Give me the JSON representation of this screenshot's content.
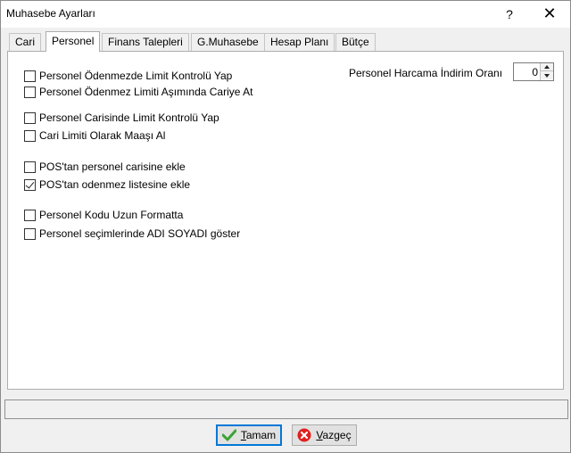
{
  "window": {
    "title": "Muhasebe Ayarları",
    "help_label": "?",
    "close_label": "✕"
  },
  "tabs": [
    {
      "label": "Cari",
      "active": false
    },
    {
      "label": "Personel",
      "active": true
    },
    {
      "label": "Finans Talepleri",
      "active": false
    },
    {
      "label": "G.Muhasebe",
      "active": false
    },
    {
      "label": "Hesap Planı",
      "active": false
    },
    {
      "label": "Bütçe",
      "active": false
    }
  ],
  "options": [
    {
      "label": "Personel Ödenmezde Limit Kontrolü Yap",
      "checked": false
    },
    {
      "label": "Personel Ödenmez Limiti Aşımında Cariye At",
      "checked": false
    },
    {
      "label": "Personel Carisinde Limit Kontrolü Yap",
      "checked": false
    },
    {
      "label": "Cari Limiti Olarak Maaşı Al",
      "checked": false
    },
    {
      "label": "POS'tan personel carisine ekle",
      "checked": false
    },
    {
      "label": "POS'tan odenmez listesine ekle",
      "checked": true
    },
    {
      "label": "Personel Kodu Uzun Formatta",
      "checked": false
    },
    {
      "label": "Personel seçimlerinde ADI SOYADI göster",
      "checked": false
    }
  ],
  "discount_rate": {
    "label": "Personel Harcama İndirim Oranı",
    "value": "0"
  },
  "statusbar": {
    "text": ""
  },
  "buttons": {
    "ok_label": "Tamam",
    "cancel_label": "Vazgeç",
    "ok_icon": "checkmark-icon",
    "cancel_icon": "cancel-x-icon"
  },
  "colors": {
    "ok_icon": "#3aa335",
    "cancel_icon": "#e02020",
    "focus_border": "#0078d7"
  }
}
